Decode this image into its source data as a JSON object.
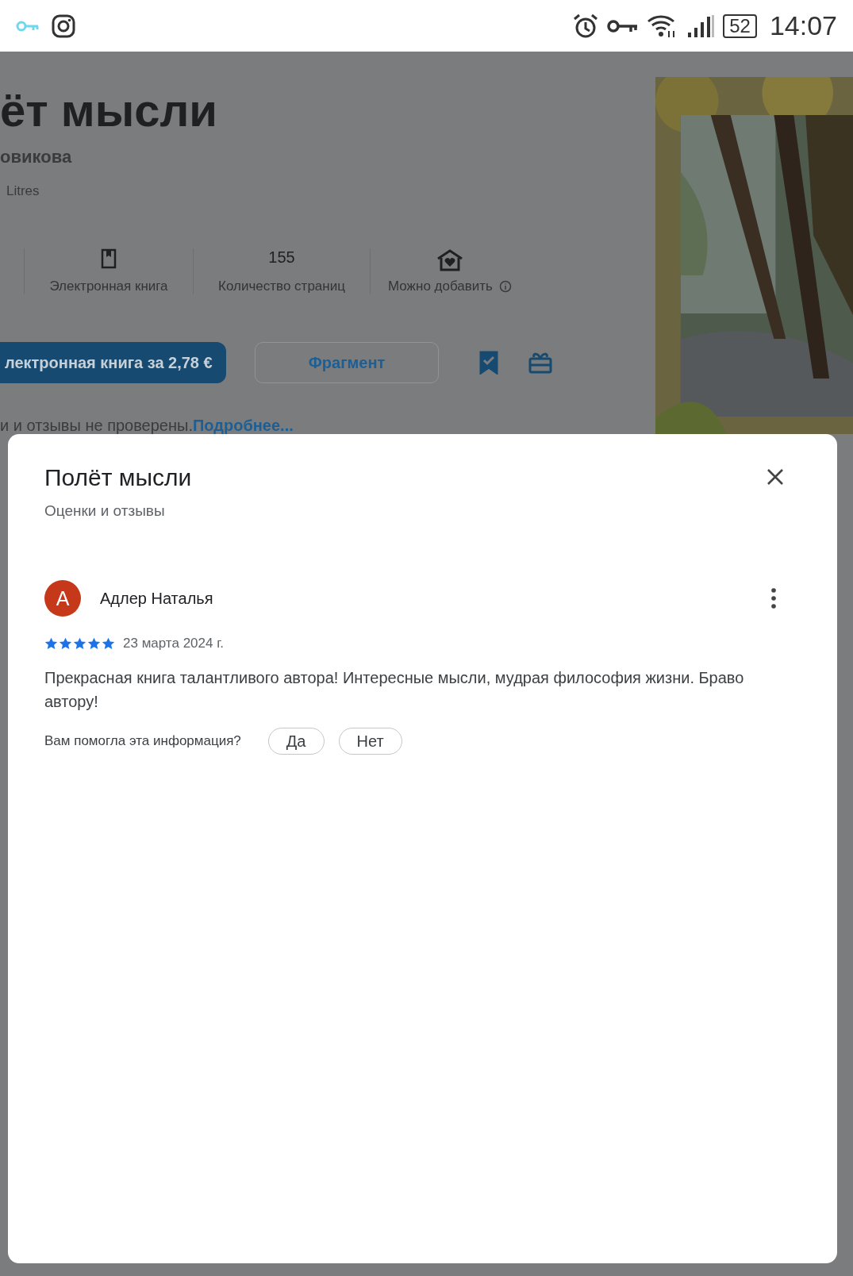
{
  "status_bar": {
    "time": "14:07",
    "battery": "52"
  },
  "page": {
    "title": "ёт мысли",
    "author": "овикова",
    "publisher": "Litres",
    "stats": [
      {
        "kind": "ebook",
        "label": "Электронная книга"
      },
      {
        "kind": "pages",
        "value": "155",
        "label": "Количество страниц"
      },
      {
        "kind": "family",
        "label": "Можно добавить"
      }
    ],
    "buy_button": "лектронная книга за 2,78 €",
    "sample_button": "Фрагмент",
    "wishlist_added": true,
    "disclaimer": "и и отзывы не проверены.",
    "more_link": "Подробнее..."
  },
  "dialog": {
    "title": "Полёт мысли",
    "subtitle": "Оценки и отзывы",
    "review": {
      "author": "Адлер Наталья",
      "avatar_letter": "А",
      "stars": 5,
      "date": "23 марта 2024 г.",
      "text": "Прекрасная книга талантливого автора! Интересные мысли, мудрая философия жизни. Браво автору!",
      "helpful_question": "Вам помогла эта информация?",
      "helpful_buttons": [
        "Да",
        "Нет"
      ]
    }
  }
}
